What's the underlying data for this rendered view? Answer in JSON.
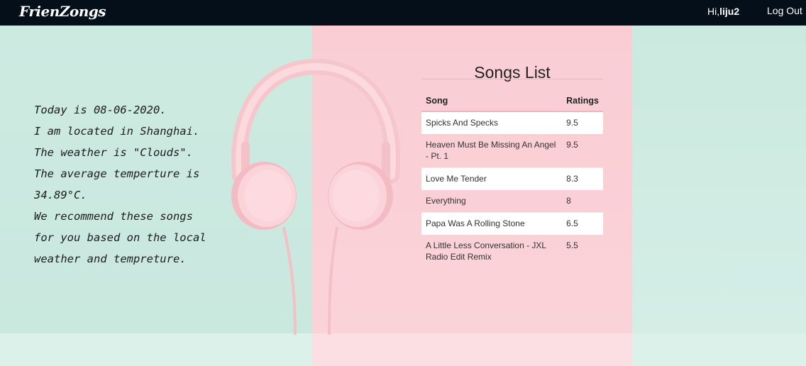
{
  "nav": {
    "brand": "FrienZongs",
    "greeting_prefix": "Hi,",
    "username": "liju2",
    "logout_label": "Log Out"
  },
  "weather": {
    "lines": [
      "Today is 08-06-2020.",
      "I am located in Shanghai.",
      "The weather is \"Clouds\".",
      "The average temperture is",
      "34.89°C.",
      "We recommend these songs",
      "for you based on the local",
      "weather and tempreture."
    ]
  },
  "songs": {
    "title": "Songs List",
    "headers": {
      "song": "Song",
      "rating": "Ratings"
    },
    "rows": [
      {
        "song": "Spicks And Specks",
        "rating": "9.5"
      },
      {
        "song": "Heaven Must Be Missing An Angel - Pt. 1",
        "rating": "9.5"
      },
      {
        "song": "Love Me Tender",
        "rating": "8.3"
      },
      {
        "song": "Everything",
        "rating": "8"
      },
      {
        "song": "Papa Was A Rolling Stone",
        "rating": "6.5"
      },
      {
        "song": "A Little Less Conversation - JXL Radio Edit Remix",
        "rating": "5.5"
      }
    ]
  },
  "colors": {
    "navbar": "#050f1a",
    "mint": "#cdeae1",
    "pink": "#f9cdd3"
  },
  "decor": {
    "background_image": "headphones-illustration"
  }
}
